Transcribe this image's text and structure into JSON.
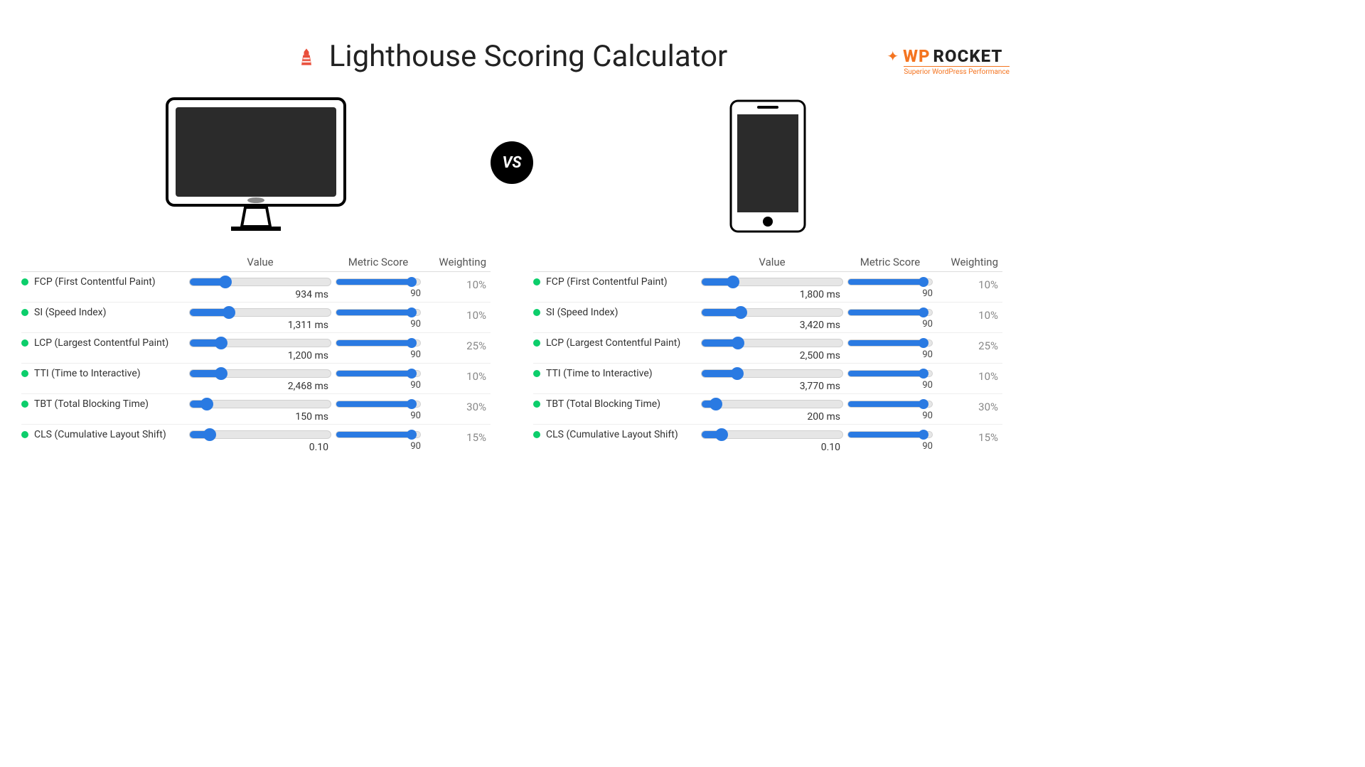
{
  "title": "Lighthouse Scoring Calculator",
  "logo": {
    "brand1": "WP",
    "brand2": "ROCKET",
    "tagline": "Superior WordPress Performance"
  },
  "vs": "VS",
  "headers": {
    "value": "Value",
    "score": "Metric Score",
    "weight": "Weighting"
  },
  "panels": [
    {
      "device": "desktop",
      "metrics": [
        {
          "label": "FCP (First Contentful Paint)",
          "value": "934 ms",
          "value_pct": 25,
          "score": "90",
          "score_pct": 90,
          "weight": "10%"
        },
        {
          "label": "SI (Speed Index)",
          "value": "1,311 ms",
          "value_pct": 28,
          "score": "90",
          "score_pct": 90,
          "weight": "10%"
        },
        {
          "label": "LCP (Largest Contentful Paint)",
          "value": "1,200 ms",
          "value_pct": 22,
          "score": "90",
          "score_pct": 90,
          "weight": "25%"
        },
        {
          "label": "TTI (Time to Interactive)",
          "value": "2,468 ms",
          "value_pct": 22,
          "score": "90",
          "score_pct": 90,
          "weight": "10%"
        },
        {
          "label": "TBT (Total Blocking Time)",
          "value": "150 ms",
          "value_pct": 12,
          "score": "90",
          "score_pct": 90,
          "weight": "30%"
        },
        {
          "label": "CLS (Cumulative Layout Shift)",
          "value": "0.10",
          "value_pct": 14,
          "score": "90",
          "score_pct": 90,
          "weight": "15%"
        }
      ]
    },
    {
      "device": "mobile",
      "metrics": [
        {
          "label": "FCP (First Contentful Paint)",
          "value": "1,800 ms",
          "value_pct": 22,
          "score": "90",
          "score_pct": 90,
          "weight": "10%"
        },
        {
          "label": "SI (Speed Index)",
          "value": "3,420 ms",
          "value_pct": 28,
          "score": "90",
          "score_pct": 90,
          "weight": "10%"
        },
        {
          "label": "LCP (Largest Contentful Paint)",
          "value": "2,500 ms",
          "value_pct": 26,
          "score": "90",
          "score_pct": 90,
          "weight": "25%"
        },
        {
          "label": "TTI (Time to Interactive)",
          "value": "3,770 ms",
          "value_pct": 25,
          "score": "90",
          "score_pct": 90,
          "weight": "10%"
        },
        {
          "label": "TBT (Total Blocking Time)",
          "value": "200 ms",
          "value_pct": 10,
          "score": "90",
          "score_pct": 90,
          "weight": "30%"
        },
        {
          "label": "CLS (Cumulative Layout Shift)",
          "value": "0.10",
          "value_pct": 14,
          "score": "90",
          "score_pct": 90,
          "weight": "15%"
        }
      ]
    }
  ]
}
